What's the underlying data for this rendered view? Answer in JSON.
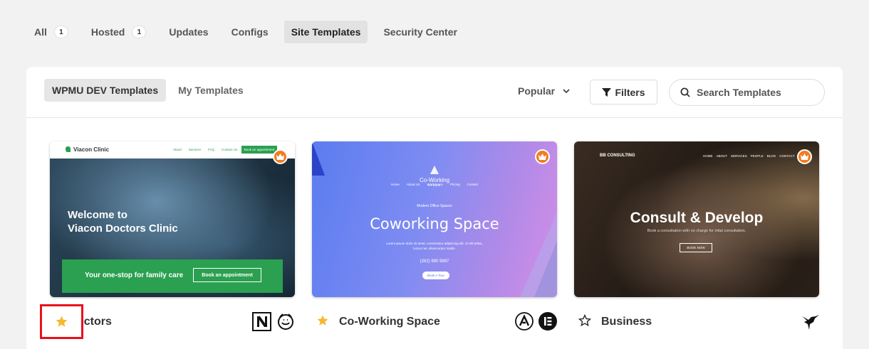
{
  "top_nav": {
    "items": [
      {
        "label": "All",
        "badge": "1"
      },
      {
        "label": "Hosted",
        "badge": "1"
      },
      {
        "label": "Updates"
      },
      {
        "label": "Configs"
      },
      {
        "label": "Site Templates",
        "active": true
      },
      {
        "label": "Security Center"
      }
    ]
  },
  "panel": {
    "sub_tabs": [
      {
        "label": "WPMU DEV Templates",
        "active": true
      },
      {
        "label": "My Templates"
      }
    ],
    "sort": {
      "label": "Popular"
    },
    "filters_label": "Filters",
    "search": {
      "placeholder": "Search Templates",
      "value": ""
    }
  },
  "cards": [
    {
      "title": "Doctors",
      "title_visible": "octors",
      "favorited": true,
      "builders": [
        "divi-icon",
        "beaver-icon"
      ],
      "preview": {
        "logo": "Viacon Clinic",
        "nav": [
          "About",
          "Services",
          "FAQ",
          "Contact Us"
        ],
        "nav_button": "Book an appointment",
        "heading_line1": "Welcome to",
        "heading_line2": "Viacon Doctors Clinic",
        "band_text": "Your one-stop for family care",
        "band_button": "Book an appointment"
      }
    },
    {
      "title": "Co-Working Space",
      "favorited": true,
      "builders": [
        "astra-icon",
        "elementor-icon"
      ],
      "preview": {
        "logo": "Co-Working",
        "logo_sub": "SPACE",
        "nav": [
          "Home",
          "About Us",
          "Workspace",
          "Pricing",
          "Contact"
        ],
        "kicker": "Modern Office Spaces",
        "heading": "Coworking Space",
        "description": "Lorem ipsum dolor sit amet, consectetur adipiscing elit. Ut elit tellus, luctus nec ullamcorper mattis.",
        "phone": "(262) 990 9997",
        "button": "Book A Tour"
      }
    },
    {
      "title": "Business",
      "favorited": false,
      "builders": [
        "hummingbird-icon"
      ],
      "preview": {
        "brand": "BB CONSULTING",
        "nav": [
          "HOME",
          "ABOUT",
          "SERVICES",
          "PEOPLE",
          "BLOG",
          "CONTACT"
        ],
        "heading": "Consult & Develop",
        "subheading": "Book a consultation with no charge for intial consultation.",
        "button": "BOOK NOW"
      }
    }
  ],
  "colors": {
    "accent_green": "#2aa050",
    "crown_orange": "#f47b20",
    "star_gold": "#f5b82e",
    "highlight_red": "#e8121b"
  }
}
